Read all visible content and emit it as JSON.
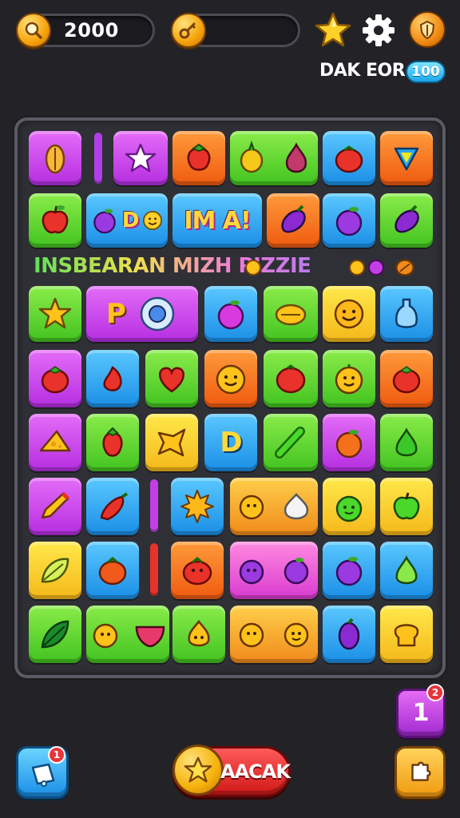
{
  "header": {
    "coins": "2000",
    "level_label": "DAK EOR",
    "level_badge": "100"
  },
  "board": {
    "puzzle_label": "INSBEARAN MIZH  PIZZIE",
    "word_tile_1": "P",
    "word_tile_2": "IM A!",
    "word_tile_3": "D",
    "letter_tile": "P",
    "letter_tile_2": "D"
  },
  "footer": {
    "hint_count": "1",
    "hint_notification": "2",
    "left_notification": "1",
    "play_label": "AACAK"
  },
  "icons": {
    "coin": "magnifier-coin-icon",
    "key": "key-icon",
    "star": "star-icon",
    "settings": "gear-icon",
    "shield": "shield-icon",
    "left_button": "bell-icon",
    "right_button": "puzzle-piece-icon"
  },
  "colors": {
    "background": "#232227",
    "tile_purple": "#c23fe6",
    "tile_green": "#4fcf2c",
    "tile_orange": "#f5701a",
    "tile_blue": "#2aa6ea",
    "tile_yellow": "#f5cf1a",
    "play_red": "#e02626"
  }
}
